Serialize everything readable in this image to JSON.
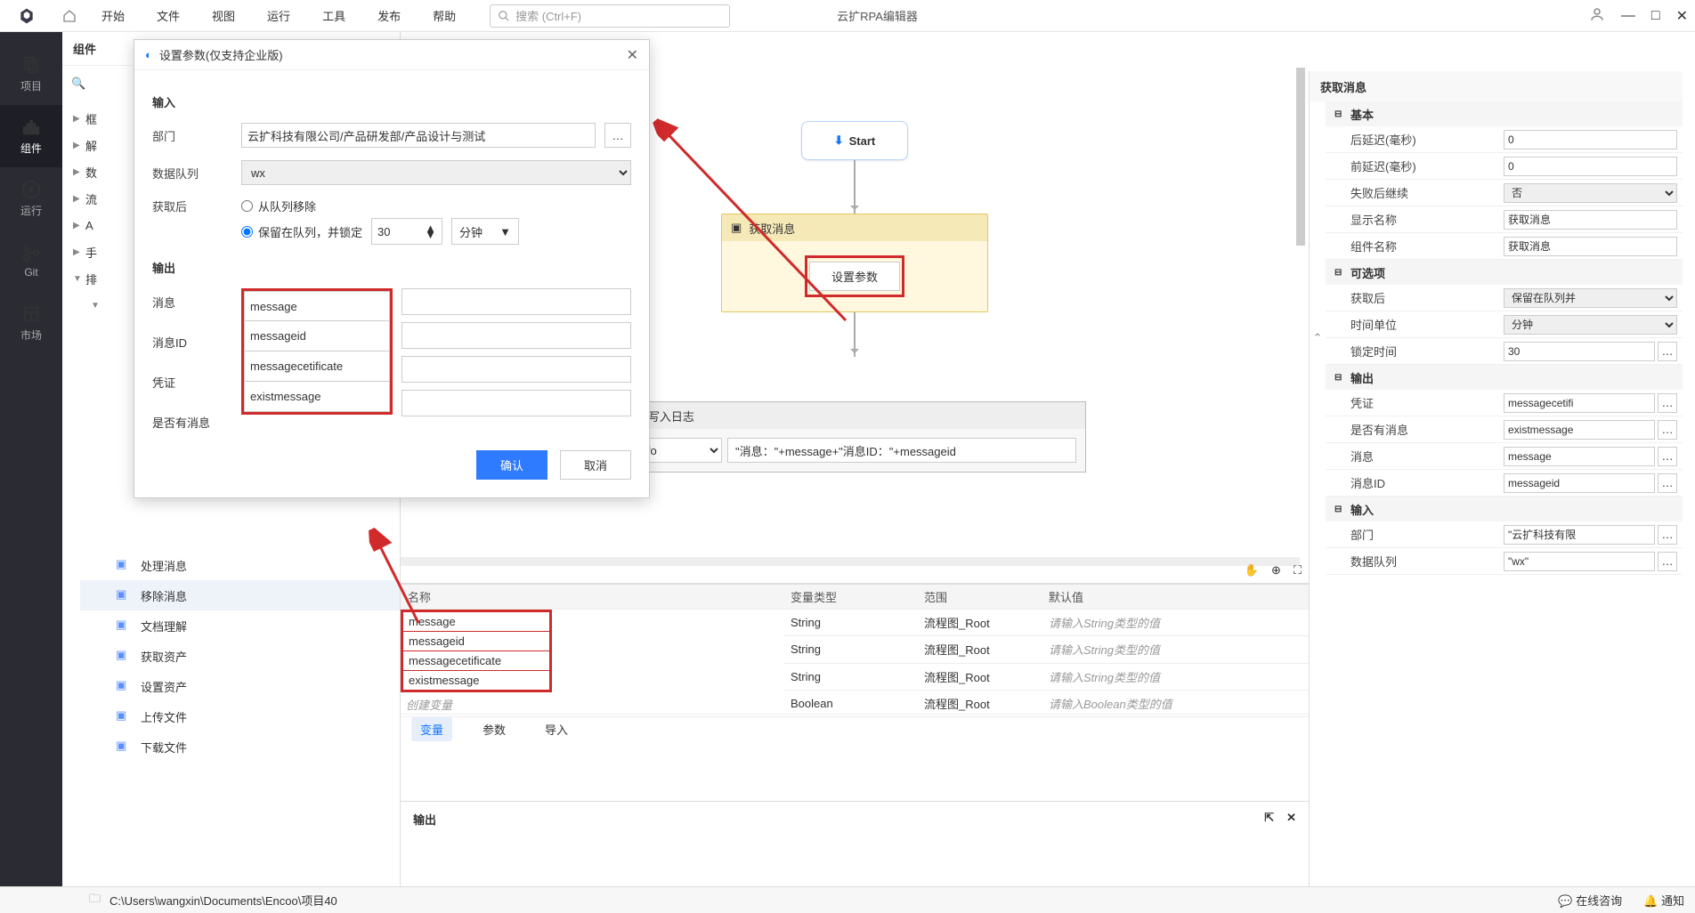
{
  "app": {
    "title": "云扩RPA编辑器",
    "search_placeholder": "搜索 (Ctrl+F)"
  },
  "menu": [
    "开始",
    "文件",
    "视图",
    "运行",
    "工具",
    "发布",
    "帮助"
  ],
  "leftbar": [
    {
      "label": "项目"
    },
    {
      "label": "组件"
    },
    {
      "label": "运行"
    },
    {
      "label": "Git"
    },
    {
      "label": "市场"
    }
  ],
  "components": {
    "title": "组件",
    "cats": [
      "框",
      "解",
      "数",
      "流",
      "A",
      "手",
      "排"
    ],
    "actions": [
      "处理消息",
      "移除消息",
      "文档理解",
      "获取资产",
      "设置资产",
      "上传文件",
      "下载文件"
    ]
  },
  "dialog": {
    "title": "设置参数(仅支持企业版)",
    "sec_in": "输入",
    "sec_out": "输出",
    "dept_label": "部门",
    "dept_val": "云扩科技有限公司/产品研发部/产品设计与测试",
    "queue_label": "数据队列",
    "queue_val": "wx",
    "after_label": "获取后",
    "opt_remove": "从队列移除",
    "opt_keep": "保留在队列，并锁定",
    "lock_val": "30",
    "lock_unit": "分钟",
    "out_msg_label": "消息",
    "out_msg": "message",
    "out_id_label": "消息ID",
    "out_id": "messageid",
    "out_cert_label": "凭证",
    "out_cert": "messagecetificate",
    "out_has_label": "是否有消息",
    "out_has": "existmessage",
    "ok": "确认",
    "cancel": "取消"
  },
  "flow": {
    "start": "Start",
    "act1": "获取消息",
    "set_param": "设置参数",
    "log_title": "写入日志",
    "log_level": "Info",
    "log_expr": "\"消息：\"+message+\"消息ID：\"+messageid"
  },
  "vars": {
    "headers": [
      "名称",
      "变量类型",
      "范围",
      "默认值"
    ],
    "rows": [
      {
        "name": "message",
        "type": "String",
        "scope": "流程图_Root",
        "def": "请输入String类型的值"
      },
      {
        "name": "messageid",
        "type": "String",
        "scope": "流程图_Root",
        "def": "请输入String类型的值"
      },
      {
        "name": "messagecetificate",
        "type": "String",
        "scope": "流程图_Root",
        "def": "请输入String类型的值"
      },
      {
        "name": "existmessage",
        "type": "Boolean",
        "scope": "流程图_Root",
        "def": "请输入Boolean类型的值"
      }
    ],
    "create": "创建变量",
    "tabs": [
      "变量",
      "参数",
      "导入"
    ]
  },
  "output": {
    "title": "输出"
  },
  "props": {
    "title": "获取消息",
    "g_basic": "基本",
    "g_opt": "可选项",
    "g_out": "输出",
    "g_in": "输入",
    "rows_basic": [
      {
        "l": "后延迟(毫秒)",
        "v": "0"
      },
      {
        "l": "前延迟(毫秒)",
        "v": "0"
      },
      {
        "l": "失败后继续",
        "v": "否",
        "sel": true
      },
      {
        "l": "显示名称",
        "v": "获取消息"
      },
      {
        "l": "组件名称",
        "v": "获取消息"
      }
    ],
    "rows_opt": [
      {
        "l": "获取后",
        "v": "保留在队列并",
        "sel": true
      },
      {
        "l": "时间单位",
        "v": "分钟",
        "sel": true
      },
      {
        "l": "锁定时间",
        "v": "30",
        "dots": true
      }
    ],
    "rows_out": [
      {
        "l": "凭证",
        "v": "messagecetifi",
        "dots": true
      },
      {
        "l": "是否有消息",
        "v": "existmessage",
        "dots": true
      },
      {
        "l": "消息",
        "v": "message",
        "dots": true
      },
      {
        "l": "消息ID",
        "v": "messageid",
        "dots": true
      }
    ],
    "rows_in": [
      {
        "l": "部门",
        "v": "\"云扩科技有限",
        "dots": true
      },
      {
        "l": "数据队列",
        "v": "\"wx\"",
        "dots": true
      }
    ]
  },
  "status": {
    "path": "C:\\Users\\wangxin\\Documents\\Encoo\\项目40",
    "online": "在线咨询",
    "notify": "通知"
  }
}
